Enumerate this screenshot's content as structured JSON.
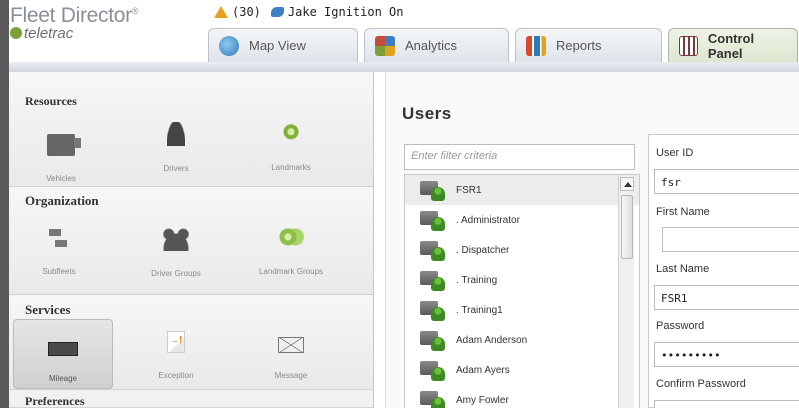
{
  "brand": {
    "name": "Fleet Director",
    "sub": "teletrac"
  },
  "alerts": {
    "count_text": "(30)",
    "ignition_text": "Jake Ignition On"
  },
  "tabs": [
    {
      "label": "Map View",
      "icon": "globe-icon"
    },
    {
      "label": "Analytics",
      "icon": "analytics-icon"
    },
    {
      "label": "Reports",
      "icon": "reports-icon"
    },
    {
      "label": "Control Panel",
      "icon": "control-panel-icon",
      "active": true
    }
  ],
  "nav": {
    "resources": {
      "title": "Resources",
      "items": [
        "Vehicles",
        "Drivers",
        "Landmarks"
      ]
    },
    "organization": {
      "title": "Organization",
      "items": [
        "Subfleets",
        "Driver Groups",
        "Landmark Groups"
      ]
    },
    "services": {
      "title": "Services",
      "items": [
        "Mileage",
        "Exception",
        "Message"
      ],
      "selected": "Mileage"
    },
    "preferences": {
      "title": "Preferences"
    }
  },
  "main": {
    "title": "Users",
    "filter_placeholder": "Enter filter criteria",
    "users": [
      "FSR1",
      ". Administrator",
      ". Dispatcher",
      ". Training",
      ". Training1",
      "Adam Anderson",
      "Adam Ayers",
      "Amy Fowler"
    ],
    "selected_user": "FSR1"
  },
  "form": {
    "user_id_label": "User ID",
    "user_id_value": "fsr",
    "first_name_label": "First Name",
    "first_name_value": "",
    "last_name_label": "Last Name",
    "last_name_value": "FSR1",
    "password_label": "Password",
    "password_value": "•••••••••",
    "confirm_password_label": "Confirm Password",
    "confirm_password_value": "•••••••••"
  },
  "colors": {
    "accent_green": "#7aa236",
    "tab_blue": "#2f79b8",
    "warning": "#e8a020"
  }
}
